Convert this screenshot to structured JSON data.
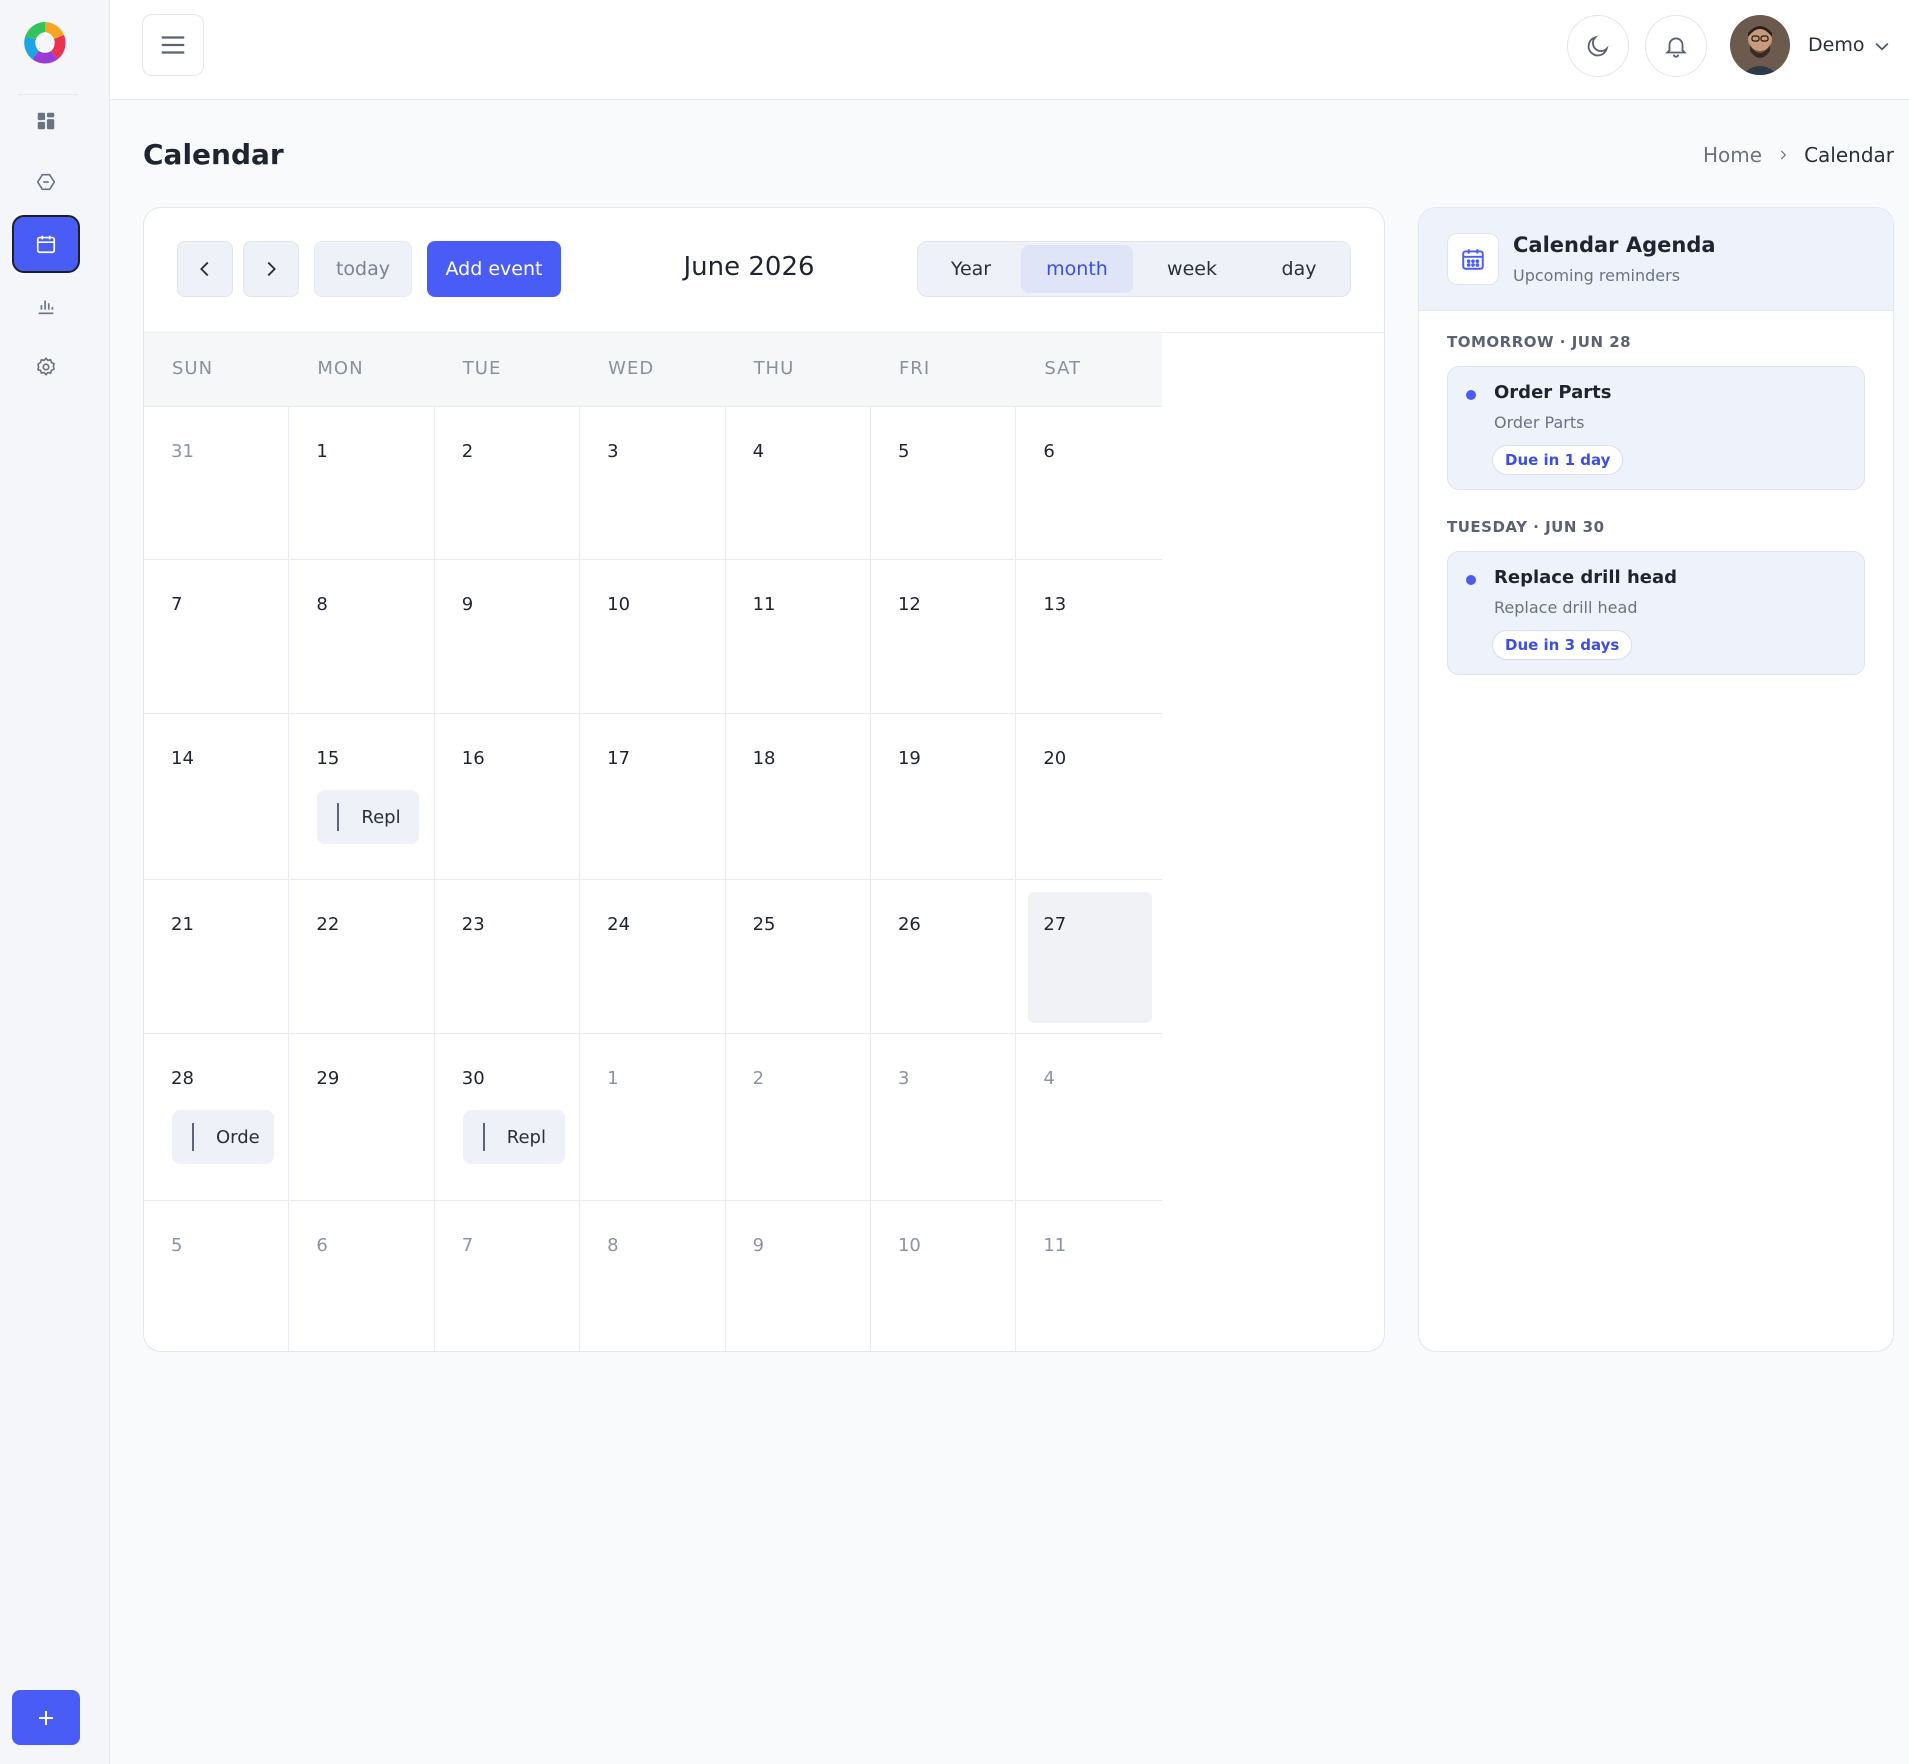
{
  "topbar": {
    "user_name": "Demo"
  },
  "page": {
    "title": "Calendar",
    "breadcrumb": [
      "Home",
      "Calendar"
    ]
  },
  "calendar": {
    "prev_icon": "chevron-left-icon",
    "next_icon": "chevron-right-icon",
    "today_label": "today",
    "add_event_label": "Add event",
    "month_title": "June 2026",
    "views": [
      "Year",
      "month",
      "week",
      "day"
    ],
    "active_view": "month",
    "weekdays": [
      "SUN",
      "MON",
      "TUE",
      "WED",
      "THU",
      "FRI",
      "SAT"
    ],
    "weeks": [
      [
        {
          "n": "31",
          "muted": true
        },
        {
          "n": "1"
        },
        {
          "n": "2"
        },
        {
          "n": "3"
        },
        {
          "n": "4"
        },
        {
          "n": "5"
        },
        {
          "n": "6"
        }
      ],
      [
        {
          "n": "7"
        },
        {
          "n": "8"
        },
        {
          "n": "9"
        },
        {
          "n": "10"
        },
        {
          "n": "11"
        },
        {
          "n": "12"
        },
        {
          "n": "13"
        }
      ],
      [
        {
          "n": "14"
        },
        {
          "n": "15",
          "event": "Repl"
        },
        {
          "n": "16"
        },
        {
          "n": "17"
        },
        {
          "n": "18"
        },
        {
          "n": "19"
        },
        {
          "n": "20"
        }
      ],
      [
        {
          "n": "21"
        },
        {
          "n": "22"
        },
        {
          "n": "23"
        },
        {
          "n": "24"
        },
        {
          "n": "25"
        },
        {
          "n": "26"
        },
        {
          "n": "27",
          "today": true
        }
      ],
      [
        {
          "n": "28",
          "event": "Orde"
        },
        {
          "n": "29"
        },
        {
          "n": "30",
          "event": "Repl"
        },
        {
          "n": "1",
          "muted": true
        },
        {
          "n": "2",
          "muted": true
        },
        {
          "n": "3",
          "muted": true
        },
        {
          "n": "4",
          "muted": true
        }
      ],
      [
        {
          "n": "5",
          "muted": true
        },
        {
          "n": "6",
          "muted": true
        },
        {
          "n": "7",
          "muted": true
        },
        {
          "n": "8",
          "muted": true
        },
        {
          "n": "9",
          "muted": true
        },
        {
          "n": "10",
          "muted": true
        },
        {
          "n": "11",
          "muted": true
        }
      ]
    ]
  },
  "agenda": {
    "title": "Calendar Agenda",
    "subtitle": "Upcoming reminders",
    "sections": [
      {
        "heading": "TOMORROW · JUN 28",
        "name": "Order Parts",
        "desc": "Order Parts",
        "badge": "Due in 1 day"
      },
      {
        "heading": "TUESDAY · JUN 30",
        "name": "Replace drill head",
        "desc": "Replace drill head",
        "badge": "Due in 3 days"
      }
    ]
  },
  "colors": {
    "accent": "#4a5cf6",
    "sidebar_bg": "#f4f6fa"
  }
}
